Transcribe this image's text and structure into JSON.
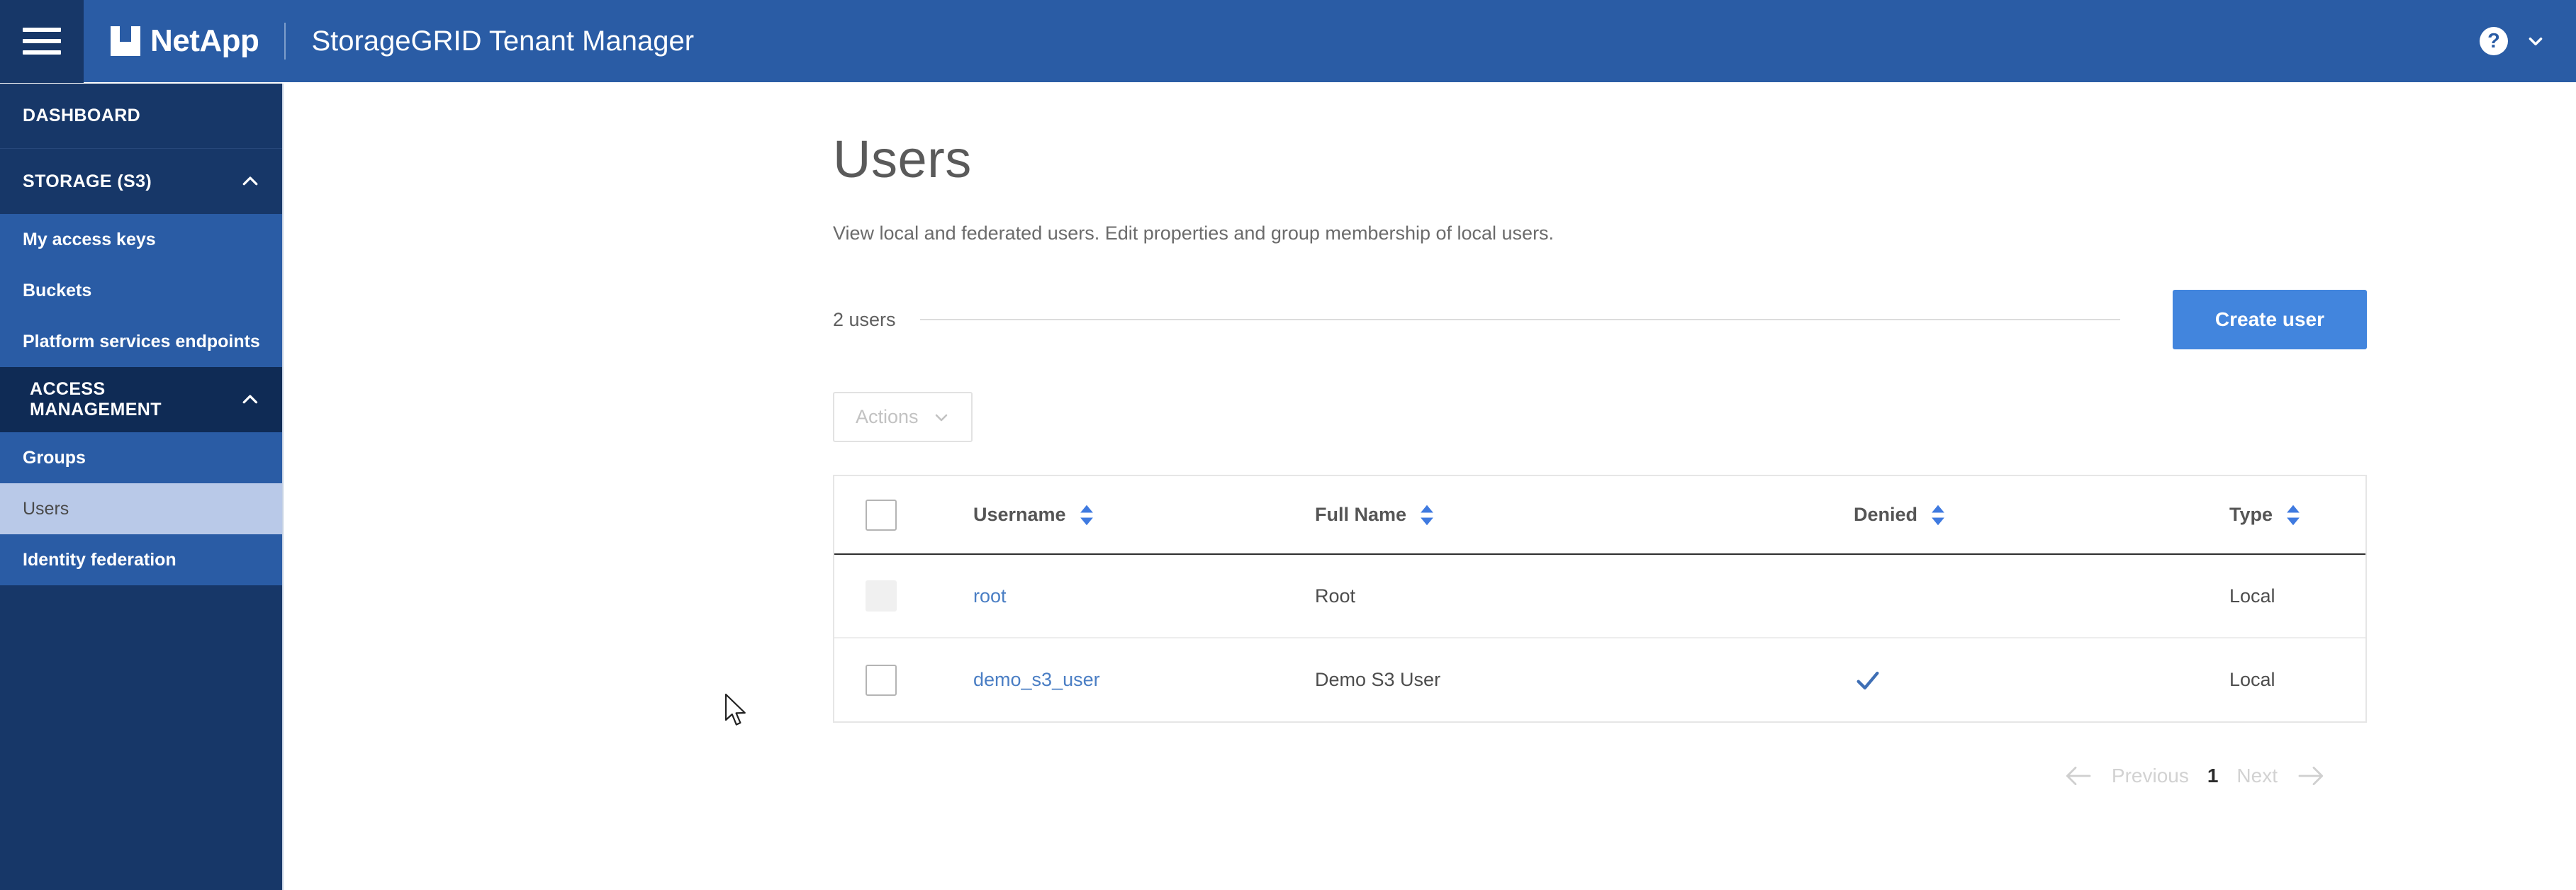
{
  "header": {
    "menu_icon": "hamburger-icon",
    "brand": "NetApp",
    "title": "StorageGRID Tenant Manager",
    "help_icon": "?",
    "help_chevron": "chevron-down-icon",
    "background": "#2a5ca5",
    "menu_background": "#173768"
  },
  "sidebar": {
    "background": "#173768",
    "accent": "#2a5ca5",
    "active_background": "#b9c9e8",
    "items": [
      {
        "label": "DASHBOARD",
        "type": "top",
        "expandable": false,
        "active": false
      },
      {
        "label": "STORAGE (S3)",
        "type": "section",
        "expandable": true,
        "expanded": true,
        "active": false
      },
      {
        "label": "My access keys",
        "type": "item",
        "active": false
      },
      {
        "label": "Buckets",
        "type": "item",
        "active": false
      },
      {
        "label": "Platform services endpoints",
        "type": "item",
        "active": false
      },
      {
        "label": "ACCESS MANAGEMENT",
        "type": "section",
        "expandable": true,
        "expanded": true,
        "active": false
      },
      {
        "label": "Groups",
        "type": "item",
        "active": false
      },
      {
        "label": "Users",
        "type": "item",
        "active": true
      },
      {
        "label": "Identity federation",
        "type": "item",
        "active": false
      }
    ]
  },
  "main": {
    "page_title": "Users",
    "page_description": "View local and federated users. Edit properties and group membership of local users.",
    "count_label": "2 users",
    "create_button": "Create user",
    "create_button_color": "#4285dd",
    "actions_button": "Actions",
    "actions_disabled": true
  },
  "table": {
    "columns": [
      {
        "key": "select",
        "label": "",
        "sortable": false
      },
      {
        "key": "username",
        "label": "Username",
        "sortable": true
      },
      {
        "key": "fullname",
        "label": "Full Name",
        "sortable": true
      },
      {
        "key": "denied",
        "label": "Denied",
        "sortable": true
      },
      {
        "key": "type",
        "label": "Type",
        "sortable": true
      }
    ],
    "rows": [
      {
        "username": "root",
        "fullname": "Root",
        "denied": false,
        "type": "Local",
        "checkbox_disabled": true,
        "checked": false
      },
      {
        "username": "demo_s3_user",
        "fullname": "Demo S3 User",
        "denied": true,
        "type": "Local",
        "checkbox_disabled": false,
        "checked": false
      }
    ],
    "link_color": "#4a7ec4",
    "check_color": "#3f6fb5",
    "sort_icon_color": "#3f7ae0"
  },
  "pagination": {
    "previous": "Previous",
    "current_page": "1",
    "next": "Next",
    "previous_enabled": false,
    "next_enabled": false
  }
}
